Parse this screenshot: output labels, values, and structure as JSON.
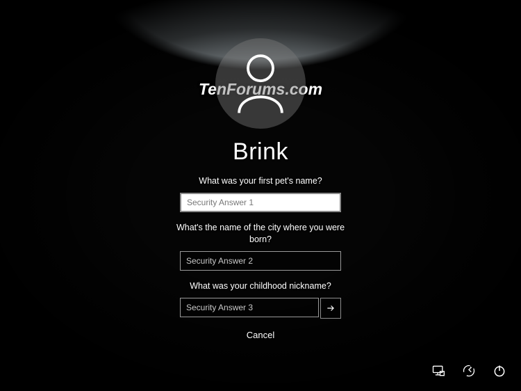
{
  "watermark": "TenForums.com",
  "user": {
    "name": "Brink"
  },
  "questions": [
    {
      "text": "What was your first pet's name?",
      "placeholder": "Security Answer 1"
    },
    {
      "text": "What's the name of the city where you were born?",
      "placeholder": "Security Answer 2"
    },
    {
      "text": "What was your childhood nickname?",
      "placeholder": "Security Answer 3"
    }
  ],
  "buttons": {
    "cancel": "Cancel",
    "submit_icon": "arrow-right-icon"
  },
  "tray": {
    "network_icon": "network-icon",
    "ease_icon": "ease-of-access-icon",
    "power_icon": "power-icon"
  }
}
